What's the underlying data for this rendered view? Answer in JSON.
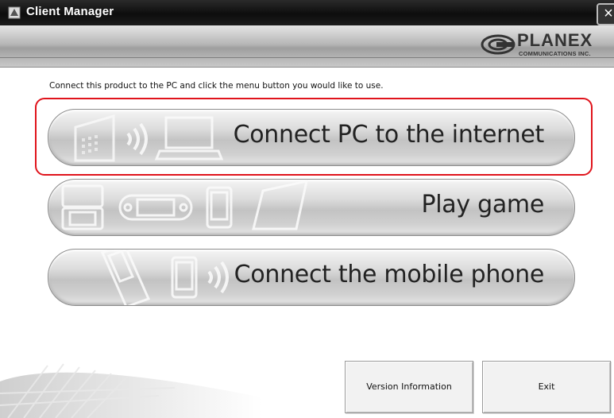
{
  "window": {
    "title": "Client Manager",
    "close_glyph": "×"
  },
  "header": {
    "brand": "PLANEX",
    "brand_sub": "COMMUNICATIONS INC."
  },
  "instruction": "Connect this product to the PC and click the menu button you would like to use.",
  "menu": [
    {
      "label": "Connect PC to the internet",
      "icons": [
        "router-icon",
        "wireless-waves-icon",
        "laptop-icon"
      ],
      "selected": true
    },
    {
      "label": "Play game",
      "icons": [
        "nintendo-ds-icon",
        "psp-icon",
        "ipod-touch-icon",
        "wii-icon"
      ],
      "selected": false
    },
    {
      "label": "Connect the mobile phone",
      "icons": [
        "mobile-phone-icon",
        "smartphone-icon",
        "wireless-waves-icon"
      ],
      "selected": false
    }
  ],
  "buttons": {
    "version_info": "Version Information",
    "exit": "Exit"
  },
  "colors": {
    "selection": "#e0141c",
    "titlebar": "#111111"
  }
}
